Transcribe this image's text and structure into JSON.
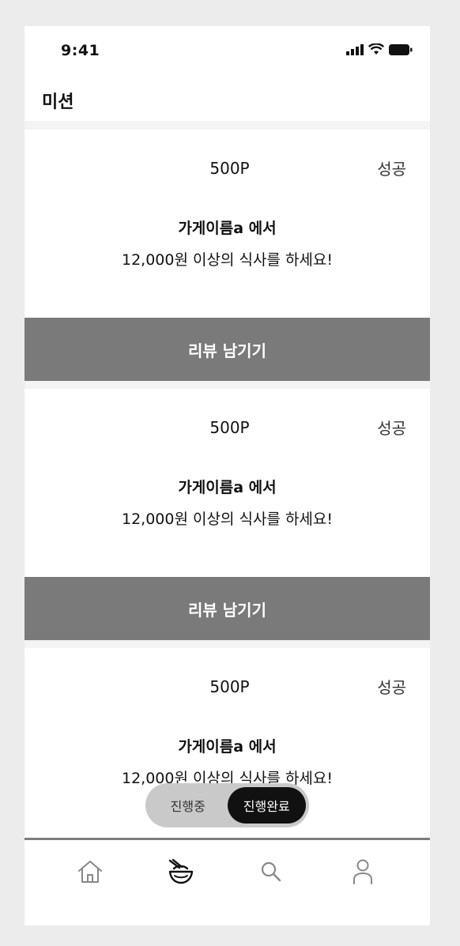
{
  "status_bar": {
    "time": "9:41"
  },
  "header": {
    "title": "미션"
  },
  "missions": [
    {
      "points": "500P",
      "status": "성공",
      "store": "가게이름a 에서",
      "description": "12,000원 이상의 식사를 하세요!",
      "button_label": "리뷰 남기기"
    },
    {
      "points": "500P",
      "status": "성공",
      "store": "가게이름a 에서",
      "description": "12,000원 이상의 식사를 하세요!",
      "button_label": "리뷰 남기기"
    },
    {
      "points": "500P",
      "status": "성공",
      "store": "가게이름a 에서",
      "description": "12,000원 이상의 식사를 하세요!"
    }
  ],
  "toggle": {
    "in_progress": "진행중",
    "completed": "진행완료",
    "selected": "진행완료"
  },
  "tabs": [
    {
      "icon": "home-icon"
    },
    {
      "icon": "food-bowl-icon"
    },
    {
      "icon": "search-icon"
    },
    {
      "icon": "user-icon"
    }
  ]
}
